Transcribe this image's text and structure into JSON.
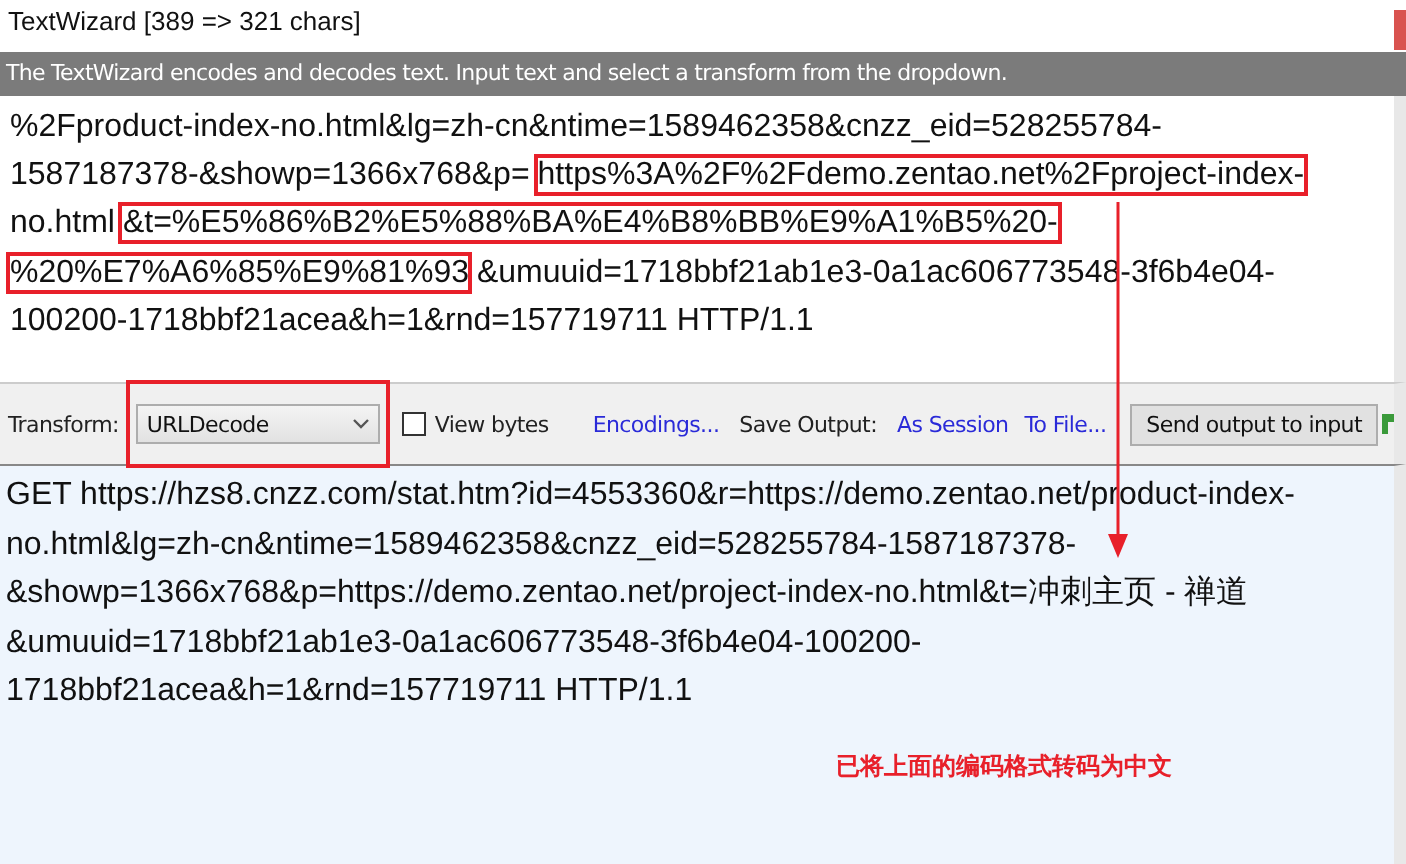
{
  "window": {
    "title": "TextWizard [389 => 321 chars]"
  },
  "description": "The TextWizard encodes and decodes text. Input text and select a transform from the dropdown.",
  "input": {
    "lines": [
      [
        {
          "text": "%2Fproduct-index-no.html&lg=zh-cn&ntime=1589462358&cnzz_eid=528255784-",
          "boxed": false
        }
      ],
      [
        {
          "text": "1587187378-&showp=1366x768&p=",
          "boxed": false
        },
        {
          "text": "https%3A%2F%2Fdemo.zentao.net%2Fproject-index-",
          "boxed": true
        }
      ],
      [
        {
          "text": "no.html",
          "boxed": false
        },
        {
          "text": "&t=%E5%86%B2%E5%88%BA%E4%B8%BB%E9%A1%B5%20-",
          "boxed": true
        }
      ],
      [
        {
          "text": "%20%E7%A6%85%E9%81%93",
          "boxed": true
        },
        {
          "text": "&umuuid=1718bbf21ab1e3-0a1ac606773548-3f6b4e04-",
          "boxed": false
        }
      ],
      [
        {
          "text": "100200-1718bbf21acea&h=1&rnd=157719711 HTTP/1.1",
          "boxed": false
        }
      ]
    ]
  },
  "toolbar": {
    "transform_label": "Transform:",
    "transform_value": "URLDecode",
    "transform_boxed": true,
    "view_bytes": {
      "label": "View bytes",
      "checked": false
    },
    "encodings": "Encodings...",
    "save_output_label": "Save Output:",
    "as_session": "As Session",
    "to_file": "To File...",
    "send_button": "Send output to input"
  },
  "output": {
    "lines": [
      "GET https://hzs8.cnzz.com/stat.htm?id=4553360&r=https://demo.zentao.net/product-index-",
      "no.html&lg=zh-cn&ntime=1589462358&cnzz_eid=528255784-1587187378-",
      "&showp=1366x768&p=https://demo.zentao.net/project-index-no.html&t=冲刺主页 - 禅道",
      "&umuuid=1718bbf21ab1e3-0a1ac606773548-3f6b4e04-100200-",
      "1718bbf21acea&h=1&rnd=157719711 HTTP/1.1"
    ]
  },
  "annotation": "已将上面的编码格式转码为中文"
}
